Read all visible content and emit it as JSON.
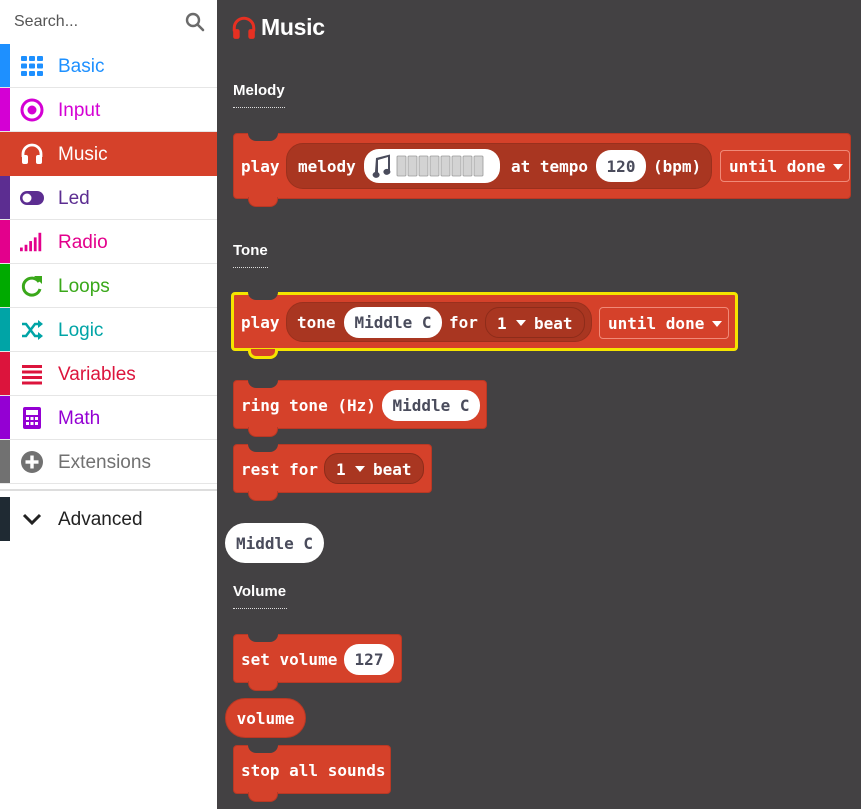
{
  "search": {
    "placeholder": "Search..."
  },
  "categories": [
    {
      "label": "Basic",
      "color": "#1e90ff",
      "icon": "grid-icon"
    },
    {
      "label": "Input",
      "color": "#d400d4",
      "icon": "radio-target-icon"
    },
    {
      "label": "Music",
      "color": "#e63022",
      "icon": "headphones-icon",
      "selected": true
    },
    {
      "label": "Led",
      "color": "#5c2d91",
      "icon": "toggle-icon"
    },
    {
      "label": "Radio",
      "color": "#e3008c",
      "icon": "signal-bars-icon"
    },
    {
      "label": "Loops",
      "color": "#00aa00",
      "icon": "refresh-icon"
    },
    {
      "label": "Logic",
      "color": "#00a4a6",
      "icon": "shuffle-icon"
    },
    {
      "label": "Variables",
      "color": "#dc143c",
      "icon": "list-lines-icon"
    },
    {
      "label": "Math",
      "color": "#9400d3",
      "icon": "calculator-icon"
    },
    {
      "label": "Extensions",
      "color": "#717171",
      "icon": "plus-circle-icon"
    },
    {
      "label": "Advanced",
      "color": "#1f2a33",
      "icon": "chevron-down-icon"
    }
  ],
  "flyout": {
    "title": "Music",
    "sections": {
      "melody": "Melody",
      "tone": "Tone",
      "volume": "Volume"
    },
    "play_melody": {
      "play": "play",
      "melody": "melody",
      "at_tempo": "at tempo",
      "tempo": "120",
      "bpm": "(bpm)",
      "mode": "until done"
    },
    "play_tone": {
      "play": "play",
      "tone": "tone",
      "note": "Middle C",
      "for": "for",
      "beats": "1",
      "beat": "beat",
      "mode": "until done"
    },
    "ring_tone": {
      "label": "ring tone (Hz)",
      "note": "Middle C"
    },
    "rest_for": {
      "label": "rest for",
      "beats": "1",
      "beat": "beat"
    },
    "note_reporter": "Middle C",
    "set_volume": {
      "label": "set volume",
      "value": "127"
    },
    "volume_reporter": "volume",
    "stop_all": "stop all sounds"
  }
}
